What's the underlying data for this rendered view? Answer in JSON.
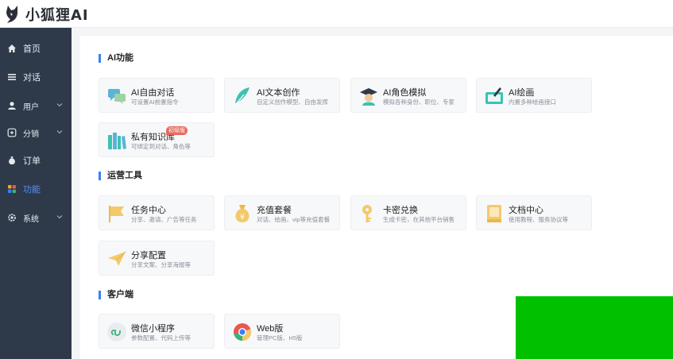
{
  "app": {
    "logo_text": "小狐狸AI",
    "accent": "#3b7ef6",
    "sidebar_bg": "#2e3a4a"
  },
  "sidebar": {
    "items": [
      {
        "label": "首页",
        "icon": "home-icon",
        "has_children": false,
        "active": false
      },
      {
        "label": "对话",
        "icon": "list-icon",
        "has_children": false,
        "active": false
      },
      {
        "label": "用户",
        "icon": "user-icon",
        "has_children": true,
        "active": false
      },
      {
        "label": "分销",
        "icon": "share-icon",
        "has_children": true,
        "active": false
      },
      {
        "label": "订单",
        "icon": "money-bag-icon",
        "has_children": false,
        "active": false
      },
      {
        "label": "功能",
        "icon": "grid-icon",
        "has_children": false,
        "active": true
      },
      {
        "label": "系统",
        "icon": "gear-icon",
        "has_children": true,
        "active": false
      }
    ]
  },
  "sections": [
    {
      "title": "AI功能",
      "cards": [
        {
          "title": "AI自由对话",
          "desc": "可设置AI前置指令",
          "icon": "chat-bubbles-icon"
        },
        {
          "title": "AI文本创作",
          "desc": "自定义创作模型、自由发挥",
          "icon": "feather-icon"
        },
        {
          "title": "AI角色模拟",
          "desc": "模拟各种身份、职位、专家",
          "icon": "graduate-icon"
        },
        {
          "title": "AI绘画",
          "desc": "内置多种绘画接口",
          "icon": "paint-icon"
        },
        {
          "title": "私有知识库",
          "desc": "可绑定到对话、角色等",
          "icon": "books-icon",
          "badge": "初级版"
        }
      ]
    },
    {
      "title": "运营工具",
      "cards": [
        {
          "title": "任务中心",
          "desc": "分享、邀请、广告等任务",
          "icon": "flag-icon"
        },
        {
          "title": "充值套餐",
          "desc": "对话、绘画、vip等充值套餐",
          "icon": "money-bag-icon"
        },
        {
          "title": "卡密兑换",
          "desc": "生成卡密，在其他平台销售",
          "icon": "key-icon"
        },
        {
          "title": "文档中心",
          "desc": "使用教程、服务协议等",
          "icon": "book-icon"
        },
        {
          "title": "分享配置",
          "desc": "分享文案、分享海报等",
          "icon": "paper-plane-icon"
        }
      ]
    },
    {
      "title": "客户端",
      "cards": [
        {
          "title": "微信小程序",
          "desc": "参数配置、代码上传等",
          "icon": "mini-program-icon"
        },
        {
          "title": "Web版",
          "desc": "管理PC版、H5版",
          "icon": "chrome-icon"
        }
      ]
    }
  ]
}
